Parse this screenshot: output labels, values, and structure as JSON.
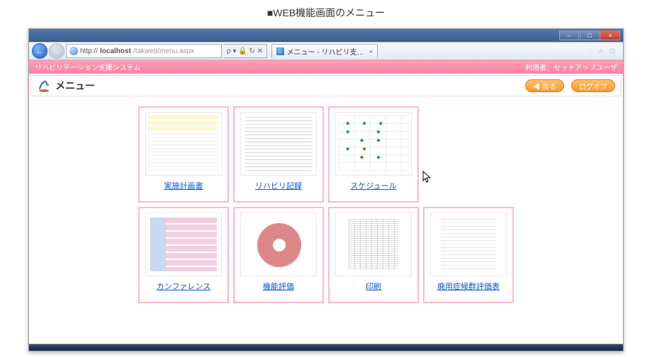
{
  "header_text": "■WEB機能画面のメニュー",
  "window": {
    "min": "–",
    "max": "□",
    "close": "×"
  },
  "nav": {
    "back_glyph": "←",
    "fwd_glyph": "→",
    "url_prefix": "http://",
    "url_host": "localhost",
    "url_path": "/takweb/menu.aspx",
    "tools": "ρ ▾ 🔒 ↻ ✕",
    "tab_title": "メニュー - リハビリ支援...",
    "tab_close": "×",
    "home_glyph": "⌂",
    "star_glyph": "★",
    "gear_glyph": "✿"
  },
  "system": {
    "name": "リハビリテーション支援システム",
    "user_label": "利用者：セットアップユーザ"
  },
  "page": {
    "title": "メニュー",
    "back_btn": "◀ 戻る",
    "logoff_btn": "ログオフ"
  },
  "menu_items": [
    {
      "label": "実施計画書",
      "thumb_class": "t-form"
    },
    {
      "label": "リハビリ記録",
      "thumb_class": "t-text"
    },
    {
      "label": "スケジュール",
      "thumb_class": "t-sched"
    },
    {
      "label": "",
      "thumb_class": "",
      "empty": true
    },
    {
      "label": "カンファレンス",
      "thumb_class": "t-conf"
    },
    {
      "label": "機能評価",
      "thumb_class": "t-radar"
    },
    {
      "label": "印刷",
      "thumb_class": "t-print"
    },
    {
      "label": "廃用症候群評価表",
      "thumb_class": "t-eval"
    }
  ]
}
